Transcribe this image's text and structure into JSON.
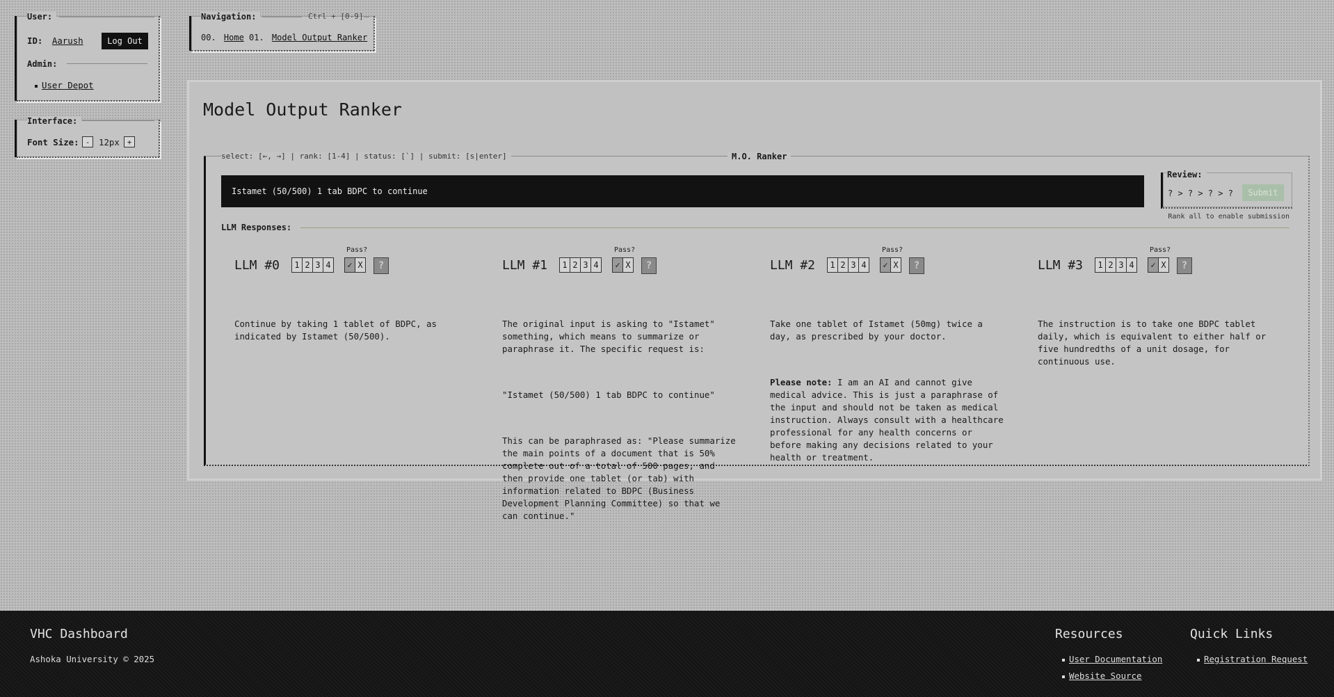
{
  "user": {
    "legend": "User:",
    "id_label": "ID:",
    "id_value": "Aarush",
    "logout_label": "Log Out",
    "admin_legend": "Admin:",
    "admin_links": [
      "User Depot"
    ]
  },
  "interface": {
    "legend": "Interface:",
    "font_size_label": "Font Size:",
    "minus": "-",
    "font_size_value": "12px",
    "plus": "+"
  },
  "navigation": {
    "legend": "Navigation:",
    "shortcut": "Ctrl + [0-9]",
    "items": [
      {
        "index": "00.",
        "label": "Home"
      },
      {
        "index": "01.",
        "label": "Model Output Ranker"
      }
    ]
  },
  "page": {
    "title": "Model Output Ranker"
  },
  "ranker": {
    "hint": "select: [←, →] | rank: [1-4] | status: [`] | submit: [s|enter]",
    "legend": "M.O. Ranker",
    "prompt": "Istamet (50/500) 1 tab BDPC to continue",
    "review_legend": "Review:",
    "review_order": "? > ? > ? > ?",
    "submit_label": "Submit",
    "submit_hint": "Rank all to enable submission",
    "responses_legend": "LLM Responses:",
    "pass_label": "Pass?",
    "ranks": [
      "1",
      "2",
      "3",
      "4"
    ],
    "pass_yes": "✓",
    "pass_no": "X",
    "unknown": "?",
    "llms": [
      {
        "title": "LLM #0",
        "paragraphs": [
          "Continue by taking 1 tablet of BDPC, as indicated by Istamet (50/500)."
        ]
      },
      {
        "title": "LLM #1",
        "paragraphs": [
          "The original input is asking to \"Istamet\" something, which means to summarize or paraphrase it. The specific request is:",
          "\"Istamet (50/500) 1 tab BDPC to continue\"",
          "This can be paraphrased as: \"Please summarize the main points of a document that is 50% complete out of a total of 500 pages, and then provide one tablet (or tab) with information related to BDPC (Business Development Planning Committee) so that we can continue.\""
        ]
      },
      {
        "title": "LLM #2",
        "paragraphs": [
          "Take one tablet of Istamet (50mg) twice a day, as prescribed by your doctor."
        ],
        "note_label": "Please note:",
        "note_text": " I am an AI and cannot give medical advice. This is just a paraphrase of the input and should not be taken as medical instruction. Always consult with a healthcare professional for any health concerns or before making any decisions related to your health or treatment."
      },
      {
        "title": "LLM #3",
        "paragraphs": [
          "The instruction is to take one BDPC tablet daily, which is equivalent to either half or five hundredths of a unit dosage, for continuous use."
        ]
      }
    ]
  },
  "footer": {
    "brand": "VHC Dashboard",
    "copyright": "Ashoka University © 2025",
    "resources_title": "Resources",
    "resources": [
      "User Documentation",
      "Website Source"
    ],
    "quick_title": "Quick Links",
    "quick": [
      "Registration Request"
    ]
  }
}
